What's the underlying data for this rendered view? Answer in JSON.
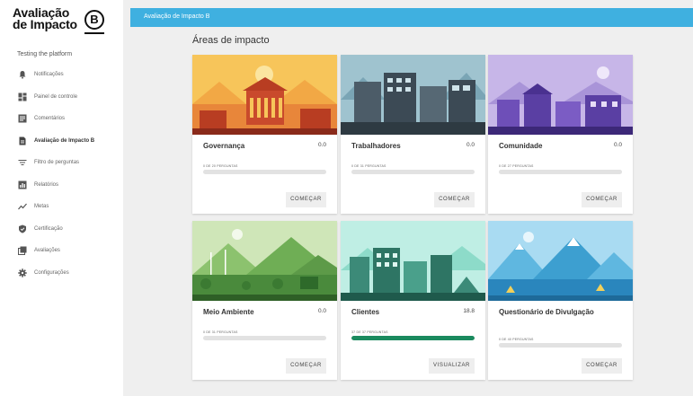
{
  "logo": {
    "line1": "Avaliação",
    "line2": "de Impacto",
    "mark": "B"
  },
  "org_name": "Testing the platform",
  "sidebar": {
    "items": [
      {
        "label": "Notificações",
        "icon": "bell-icon",
        "active": false
      },
      {
        "label": "Painel de controle",
        "icon": "dashboard-icon",
        "active": false
      },
      {
        "label": "Comentários",
        "icon": "comment-icon",
        "active": false
      },
      {
        "label": "Avaliação de Impacto B",
        "icon": "document-icon",
        "active": true
      },
      {
        "label": "Filtro de perguntas",
        "icon": "filter-icon",
        "active": false
      },
      {
        "label": "Relatórios",
        "icon": "chart-icon",
        "active": false
      },
      {
        "label": "Metas",
        "icon": "trend-icon",
        "active": false
      },
      {
        "label": "Certificação",
        "icon": "shield-icon",
        "active": false
      },
      {
        "label": "Avaliações",
        "icon": "library-icon",
        "active": false
      },
      {
        "label": "Configurações",
        "icon": "gear-icon",
        "active": false
      }
    ]
  },
  "topbar": {
    "title": "Avaliação de Impacto B"
  },
  "section_title": "Áreas de impacto",
  "cards": [
    {
      "title": "Governança",
      "score": "0.0",
      "progress_label": "0 DE 20 PERGUNTAS",
      "progress": 0,
      "button": "COMEÇAR",
      "theme": "governance"
    },
    {
      "title": "Trabalhadores",
      "score": "0.0",
      "progress_label": "0 DE 31 PERGUNTAS",
      "progress": 0,
      "button": "COMEÇAR",
      "theme": "workers"
    },
    {
      "title": "Comunidade",
      "score": "0.0",
      "progress_label": "0 DE 27 PERGUNTAS",
      "progress": 0,
      "button": "COMEÇAR",
      "theme": "community"
    },
    {
      "title": "Meio Ambiente",
      "score": "0.0",
      "progress_label": "0 DE 31 PERGUNTAS",
      "progress": 0,
      "button": "COMEÇAR",
      "theme": "environment"
    },
    {
      "title": "Clientes",
      "score": "18.8",
      "progress_label": "37 DE 37 PERGUNTAS",
      "progress": 100,
      "button": "VISUALIZAR",
      "theme": "customers"
    },
    {
      "title": "Questionário de Divulgação",
      "score": "",
      "progress_label": "0 DE 40 PERGUNTAS",
      "progress": 0,
      "button": "COMEÇAR",
      "theme": "disclosure"
    }
  ],
  "colors": {
    "topbar": "#3fb0e0",
    "progress": "#1a8a5e",
    "background": "#efefef"
  }
}
